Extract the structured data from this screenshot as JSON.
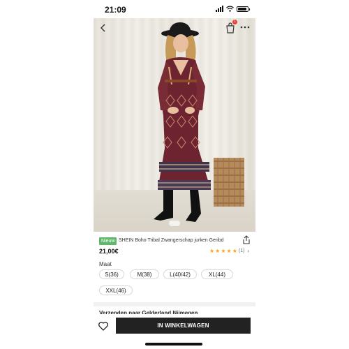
{
  "status_bar": {
    "time": "21:09"
  },
  "nav": {
    "cart_badge": "1"
  },
  "product": {
    "badge": "Nieuw",
    "title": "SHEIN Boho Tribal Zwangerschap jurken Geribd",
    "price": "21,00€",
    "rating": {
      "stars": 5,
      "count": "(1)"
    }
  },
  "sizes": {
    "label": "Maat",
    "options": [
      "S(36)",
      "M(38)",
      "L(40/42)",
      "XL(44)",
      "XXL(46)"
    ]
  },
  "shipping": {
    "text": "Verzenden naar Gelderland Nijmegen"
  },
  "actions": {
    "add_to_cart": "IN WINKELWAGEN"
  },
  "colors": {
    "accent": "#222222",
    "badge_green": "#5fb86b",
    "star": "#f5a623",
    "cart_badge": "#f23c2e"
  },
  "icons": [
    "back-arrow-icon",
    "shopping-bag-icon",
    "more-icon",
    "share-icon",
    "star-icon",
    "chevron-right-icon",
    "heart-icon"
  ]
}
